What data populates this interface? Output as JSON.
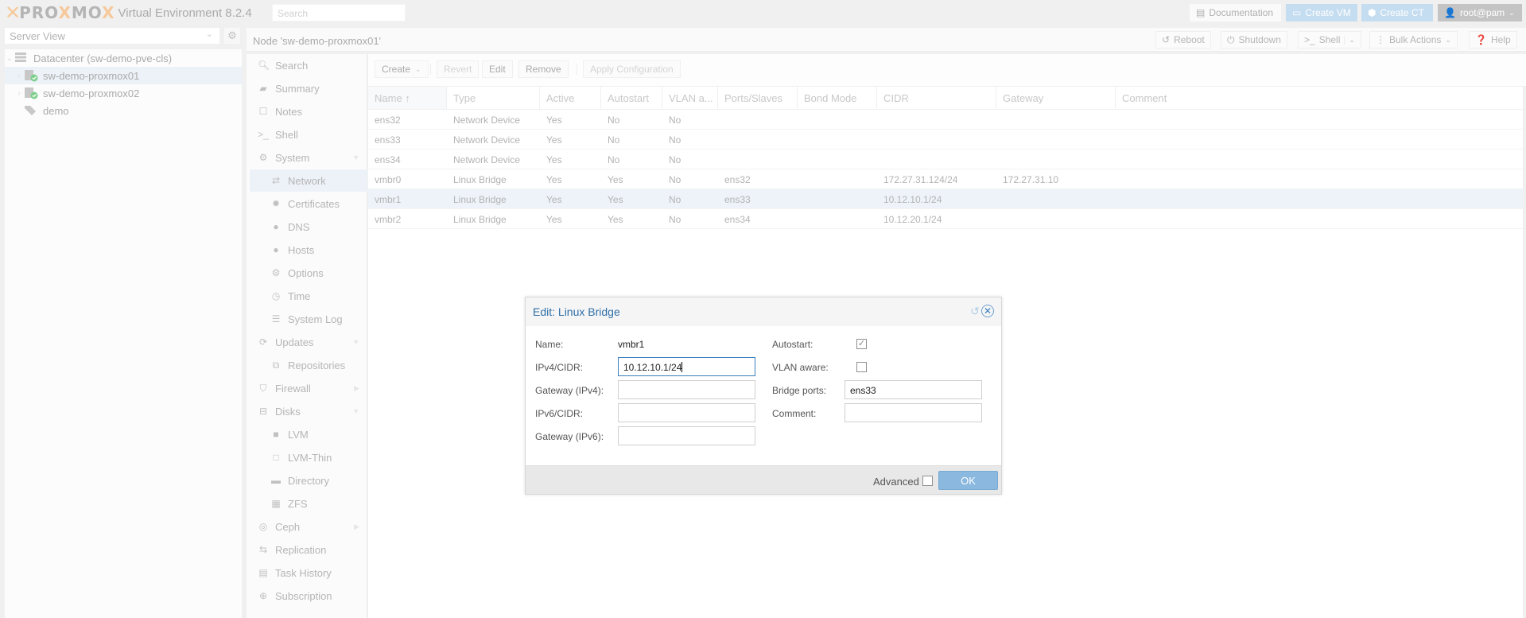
{
  "app": {
    "logo_text": "PROXMOX",
    "product": "Virtual Environment 8.2.4",
    "search_placeholder": "Search"
  },
  "topbar": {
    "documentation": "Documentation",
    "create_vm": "Create VM",
    "create_ct": "Create CT",
    "user": "root@pam"
  },
  "sidebar": {
    "view_select": "Server View",
    "tree": [
      {
        "label": "Datacenter (sw-demo-pve-cls)",
        "icon": "datacenter-icon"
      },
      {
        "label": "sw-demo-proxmox01",
        "icon": "node-online-icon",
        "selected": true
      },
      {
        "label": "sw-demo-proxmox02",
        "icon": "node-online-icon"
      },
      {
        "label": "demo",
        "icon": "tag-icon"
      }
    ]
  },
  "content": {
    "title": "Node 'sw-demo-proxmox01'",
    "buttons": {
      "reboot": "Reboot",
      "shutdown": "Shutdown",
      "shell": "Shell",
      "bulk_actions": "Bulk Actions",
      "help": "Help"
    }
  },
  "nav_menu": [
    {
      "label": "Search",
      "icon": "search-icon"
    },
    {
      "label": "Summary",
      "icon": "book-icon"
    },
    {
      "label": "Notes",
      "icon": "note-icon"
    },
    {
      "label": "Shell",
      "icon": "terminal-icon"
    },
    {
      "label": "System",
      "icon": "gears-icon",
      "expanded": true
    },
    {
      "label": "Network",
      "icon": "exchange-icon",
      "sub": true,
      "selected": true
    },
    {
      "label": "Certificates",
      "icon": "certificate-icon",
      "sub": true
    },
    {
      "label": "DNS",
      "icon": "globe-icon",
      "sub": true
    },
    {
      "label": "Hosts",
      "icon": "globe-icon",
      "sub": true
    },
    {
      "label": "Options",
      "icon": "gear-icon",
      "sub": true
    },
    {
      "label": "Time",
      "icon": "clock-icon",
      "sub": true
    },
    {
      "label": "System Log",
      "icon": "list-icon",
      "sub": true
    },
    {
      "label": "Updates",
      "icon": "refresh-icon",
      "expanded": true
    },
    {
      "label": "Repositories",
      "icon": "files-icon",
      "sub": true
    },
    {
      "label": "Firewall",
      "icon": "shield-icon",
      "collapsed": true
    },
    {
      "label": "Disks",
      "icon": "hdd-icon",
      "expanded": true
    },
    {
      "label": "LVM",
      "icon": "square-icon",
      "sub": true
    },
    {
      "label": "LVM-Thin",
      "icon": "square-outline-icon",
      "sub": true
    },
    {
      "label": "Directory",
      "icon": "folder-icon",
      "sub": true
    },
    {
      "label": "ZFS",
      "icon": "grid-icon",
      "sub": true
    },
    {
      "label": "Ceph",
      "icon": "ceph-icon",
      "collapsed": true
    },
    {
      "label": "Replication",
      "icon": "retweet-icon"
    },
    {
      "label": "Task History",
      "icon": "tasklist-icon"
    },
    {
      "label": "Subscription",
      "icon": "support-icon"
    }
  ],
  "network": {
    "toolbar": {
      "create": "Create",
      "revert": "Revert",
      "edit": "Edit",
      "remove": "Remove",
      "apply": "Apply Configuration"
    },
    "columns": [
      "Name",
      "Type",
      "Active",
      "Autostart",
      "VLAN a...",
      "Ports/Slaves",
      "Bond Mode",
      "CIDR",
      "Gateway",
      "Comment"
    ],
    "sort_indicator": "↑",
    "rows": [
      {
        "name": "ens32",
        "type": "Network Device",
        "active": "Yes",
        "autostart": "No",
        "vlan": "No",
        "ports": "",
        "bond": "",
        "cidr": "",
        "gateway": "",
        "comment": ""
      },
      {
        "name": "ens33",
        "type": "Network Device",
        "active": "Yes",
        "autostart": "No",
        "vlan": "No",
        "ports": "",
        "bond": "",
        "cidr": "",
        "gateway": "",
        "comment": ""
      },
      {
        "name": "ens34",
        "type": "Network Device",
        "active": "Yes",
        "autostart": "No",
        "vlan": "No",
        "ports": "",
        "bond": "",
        "cidr": "",
        "gateway": "",
        "comment": ""
      },
      {
        "name": "vmbr0",
        "type": "Linux Bridge",
        "active": "Yes",
        "autostart": "Yes",
        "vlan": "No",
        "ports": "ens32",
        "bond": "",
        "cidr": "172.27.31.124/24",
        "gateway": "172.27.31.10",
        "comment": ""
      },
      {
        "name": "vmbr1",
        "type": "Linux Bridge",
        "active": "Yes",
        "autostart": "Yes",
        "vlan": "No",
        "ports": "ens33",
        "bond": "",
        "cidr": "10.12.10.1/24",
        "gateway": "",
        "comment": "",
        "selected": true
      },
      {
        "name": "vmbr2",
        "type": "Linux Bridge",
        "active": "Yes",
        "autostart": "Yes",
        "vlan": "No",
        "ports": "ens34",
        "bond": "",
        "cidr": "10.12.20.1/24",
        "gateway": "",
        "comment": ""
      }
    ]
  },
  "dialog": {
    "title": "Edit: Linux Bridge",
    "fields": {
      "name_label": "Name:",
      "name_value": "vmbr1",
      "ipv4_label": "IPv4/CIDR:",
      "ipv4_value": "10.12.10.1/24",
      "gw4_label": "Gateway (IPv4):",
      "gw4_value": "",
      "ipv6_label": "IPv6/CIDR:",
      "ipv6_value": "",
      "gw6_label": "Gateway (IPv6):",
      "gw6_value": "",
      "autostart_label": "Autostart:",
      "autostart_checked": true,
      "vlan_label": "VLAN aware:",
      "vlan_checked": false,
      "ports_label": "Bridge ports:",
      "ports_value": "ens33",
      "comment_label": "Comment:",
      "comment_value": ""
    },
    "advanced_label": "Advanced",
    "advanced_checked": false,
    "ok_label": "OK"
  }
}
